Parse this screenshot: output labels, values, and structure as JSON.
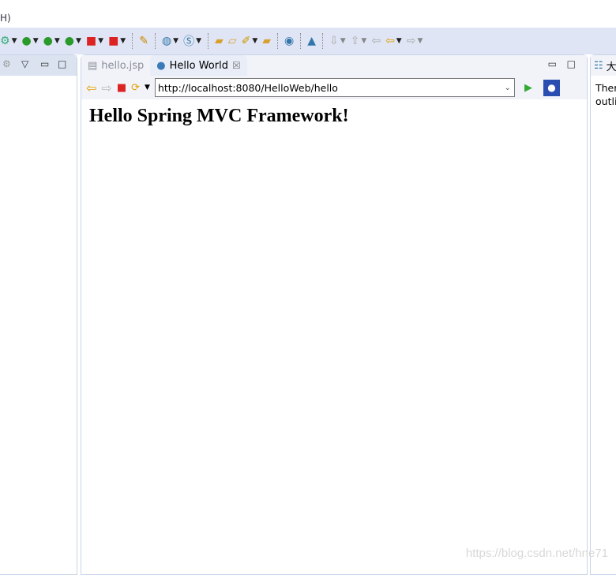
{
  "menu": {
    "partial": "H)"
  },
  "toolbar": {
    "icons": [
      "debug-icon",
      "run-icon",
      "run-server-icon",
      "run-config-icon",
      "stop-icon",
      "stop-run-icon",
      "aj-icon",
      "new-web-icon",
      "spring-icon",
      "open-folder-icon",
      "open-type-icon",
      "brush-icon",
      "open-file-icon",
      "globe-icon",
      "publish-icon",
      "next-annotation-icon",
      "prev-annotation-icon",
      "last-edit-icon",
      "back-icon",
      "forward-icon"
    ]
  },
  "editor": {
    "tabs": [
      {
        "label": "hello.jsp",
        "active": false
      },
      {
        "label": "Hello World",
        "active": true
      }
    ],
    "browser": {
      "url": "http://localhost:8080/HelloWeb/hello",
      "heading": "Hello Spring MVC Framework!"
    }
  },
  "right_panel": {
    "title": "大",
    "text1": "Ther",
    "text2": "outli"
  },
  "watermark": "https://blog.csdn.net/hne71"
}
